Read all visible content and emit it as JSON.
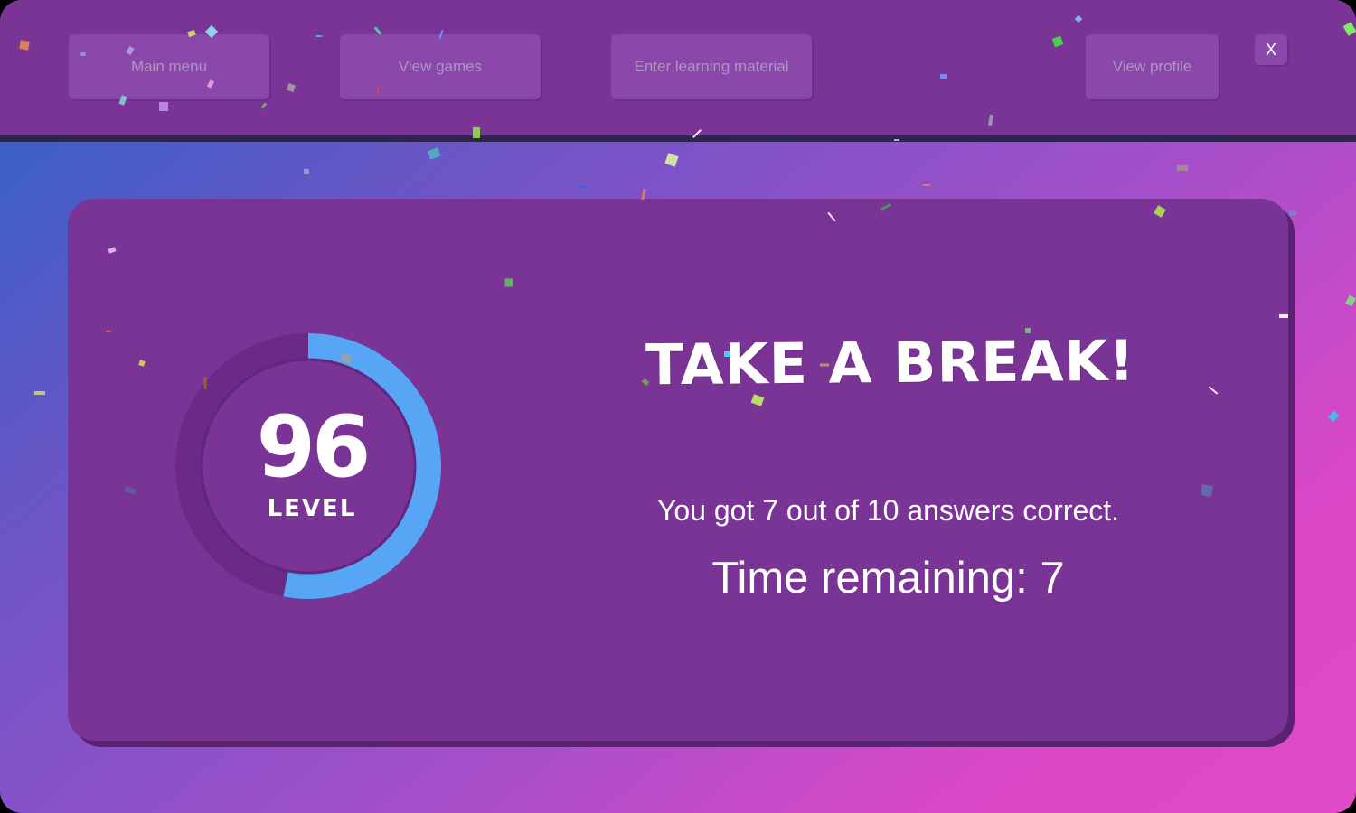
{
  "nav": {
    "main_menu": "Main menu",
    "view_games": "View games",
    "enter_learning_material": "Enter learning material",
    "view_profile": "View profile",
    "close": "X"
  },
  "level": {
    "value": "96",
    "label": "LEVEL",
    "progress_fraction": 0.53
  },
  "message": {
    "headline": "TAKE A BREAK!",
    "score_text": "You got 7 out of 10 answers correct.",
    "time_text": "Time remaining: 7"
  },
  "colors": {
    "topbar": "#7a3496",
    "card": "#7a3496",
    "ring_track": "#6a2a86",
    "ring_progress": "#56a6f5",
    "nav_button": "#8b48ab",
    "nav_text": "#b293c4"
  }
}
